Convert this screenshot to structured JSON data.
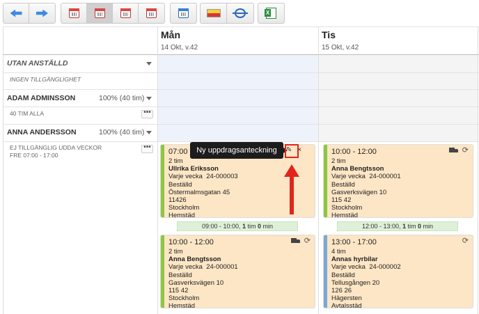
{
  "toolbar": {
    "icons": [
      "arrow-left-icon",
      "arrow-right-icon",
      "calendar-day-icon",
      "calendar-week-icon",
      "calendar-2week-icon",
      "calendar-month-icon",
      "calendar-blue-icon",
      "yellow-bar-icon",
      "compress-icon",
      "excel-icon"
    ]
  },
  "days": [
    {
      "name": "Mån",
      "sub": "14 Okt, v.42"
    },
    {
      "name": "Tis",
      "sub": "15 Okt, v.42"
    }
  ],
  "rows": {
    "unassigned": {
      "label": "UTAN ANSTÄLLD",
      "sub": "INGEN TILLGÄNGLIGHET"
    },
    "adam": {
      "label": "ADAM ADMINSSON",
      "pct": "100% (40 tim)",
      "sub": "40 TIM ALLA"
    },
    "anna": {
      "label": "ANNA ANDERSSON",
      "pct": "100% (40 tim)",
      "sub1": "EJ TILLGÄNGLIG UDDA VECKOR",
      "sub2": "FRE 07:00 - 17:00"
    }
  },
  "cards": [
    {
      "time": "07:00",
      "duration": "2 tim",
      "name": "Ullrika Eriksson",
      "freq": "Varje vecka",
      "num": "24-000003",
      "status": "Beställd",
      "street": "Östermalmsgatan 45",
      "zip": "11426",
      "city": "Stockholm",
      "service": "Hemstäd",
      "color": "#8dc63f"
    },
    {
      "time": "10:00 - 12:00",
      "duration": "2 tim",
      "name": "Anna Bengtsson",
      "freq": "Varje vecka",
      "num": "24-000001",
      "status": "Beställd",
      "street": "Gasverksvägen 10",
      "zip": "115 42",
      "city": "Stockholm",
      "service": "Hemstäd",
      "color": "#8dc63f"
    },
    {
      "time": "10:00 - 12:00",
      "duration": "2 tim",
      "name": "Anna Bengtsson",
      "freq": "Varje vecka",
      "num": "24-000001",
      "status": "Beställd",
      "street": "Gasverksvägen 10",
      "zip": "115 42",
      "city": "Stockholm",
      "service": "Hemstäd",
      "color": "#8dc63f"
    },
    {
      "time": "13:00 - 17:00",
      "duration": "4 tim",
      "name": "Annas hyrbilar",
      "freq": "Varje vecka",
      "num": "24-000002",
      "status": "Beställd",
      "street": "Tellusgången 20",
      "zip": "126 26",
      "city": "Hägersten",
      "service": "Avtalsstäd",
      "color": "#7ba7d6"
    }
  ],
  "gaps": [
    {
      "pre": "09:00 - 10:00, ",
      "b1": "1",
      "m1": " tim ",
      "b2": "0",
      "m2": " min"
    },
    {
      "pre": "12:00 - 13:00, ",
      "b1": "1",
      "m1": " tim ",
      "b2": "0",
      "m2": " min"
    }
  ],
  "tooltip": {
    "text": "Ny uppdragsanteckning"
  },
  "dots_label": "•••",
  "sync_glyph": "⟳",
  "close_glyph": "×",
  "note_glyph": "✎"
}
